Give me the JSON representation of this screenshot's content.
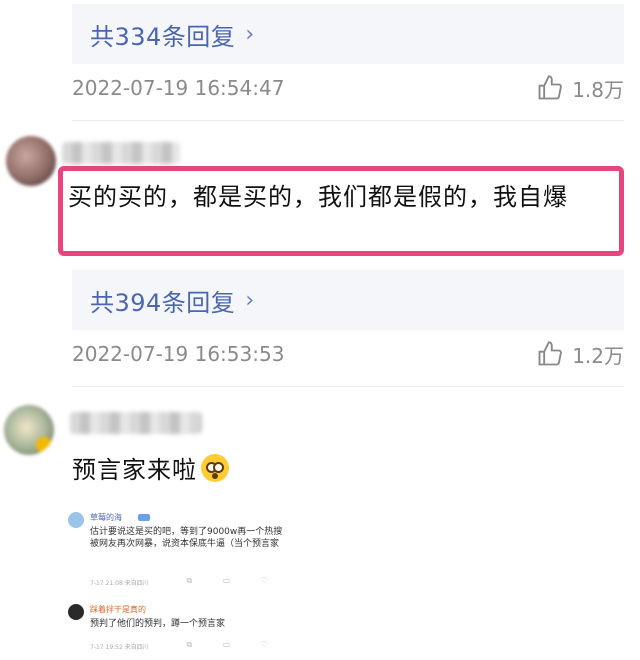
{
  "thread": {
    "first_reply_box": {
      "label": "共334条回复",
      "chevron": "›"
    },
    "first_meta": {
      "timestamp": "2022-07-19 16:54:47",
      "likes": "1.8万",
      "icon": "thumbs-up-icon"
    },
    "comment_1": {
      "text": "买的买的，都是买的，我们都是假的，我自爆"
    },
    "second_reply_box": {
      "label": "共394条回复",
      "chevron": "›"
    },
    "second_meta": {
      "timestamp": "2022-07-19 16:53:53",
      "likes": "1.2万",
      "icon": "thumbs-up-icon"
    },
    "comment_2": {
      "text": "预言家来啦",
      "emoji": "astonished-face-emoji"
    }
  },
  "embedded_screenshot": {
    "comment_a": {
      "name": "草莓的海",
      "text": "估计要说这是买的吧，等到了9000w再一个热搜被网友再次网暴，说资本保底牛逼（当个预言家",
      "meta": "7-17 21:08 来自四川",
      "icons": "⧉ ▭ ♡"
    },
    "comment_b": {
      "name": "踩着拌干是真的",
      "text": "预判了他们的预判，蹲一个预言家",
      "meta": "7-17 19:52 来自四川",
      "icons": "⧉ ▭ ♡"
    }
  },
  "colors": {
    "accent_link": "#4a66b0",
    "highlight_border": "#e8457f",
    "meta_gray": "#8a8a8a"
  }
}
